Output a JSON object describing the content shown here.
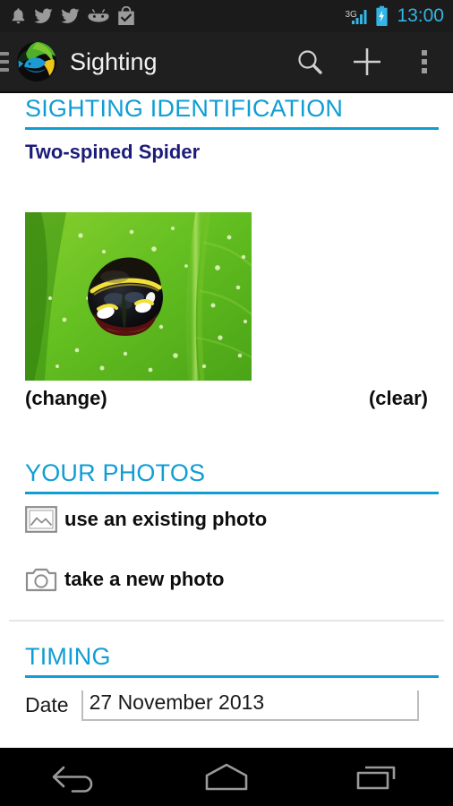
{
  "statusbar": {
    "icons": [
      "bell-icon",
      "twitter-icon",
      "twitter-icon",
      "android-icon",
      "play-store-icon"
    ],
    "network_type": "3G",
    "signal": "signal-bars-icon",
    "battery": "battery-charging-icon",
    "clock": "13:00",
    "clock_color": "#33b5e5"
  },
  "actionbar": {
    "drawer": "hamburger-menu-icon",
    "logo": "app-logo-icon",
    "title": "Sighting",
    "search": "search-icon",
    "add": "plus-icon",
    "overflow": "overflow-menu-icon",
    "background": "#1f1f1f"
  },
  "sections": {
    "identification": {
      "header": "SIGHTING IDENTIFICATION",
      "species": "Two-spined Spider",
      "photo_alt": "spider-on-leaf-photo",
      "change_label": "(change)",
      "clear_label": "(clear)"
    },
    "your_photos": {
      "header": "YOUR PHOTOS",
      "rows": [
        {
          "icon": "gallery-icon",
          "label": "use an existing photo"
        },
        {
          "icon": "camera-icon",
          "label": "take a new photo"
        }
      ]
    },
    "timing": {
      "header": "TIMING",
      "date_label": "Date",
      "date_value": "27 November 2013"
    }
  },
  "navbar": {
    "back": "back-icon",
    "home": "home-icon",
    "recents": "recents-icon"
  },
  "colors": {
    "accent": "#109dd4",
    "species": "#1b1b7a",
    "status_accent": "#33b5e5"
  }
}
